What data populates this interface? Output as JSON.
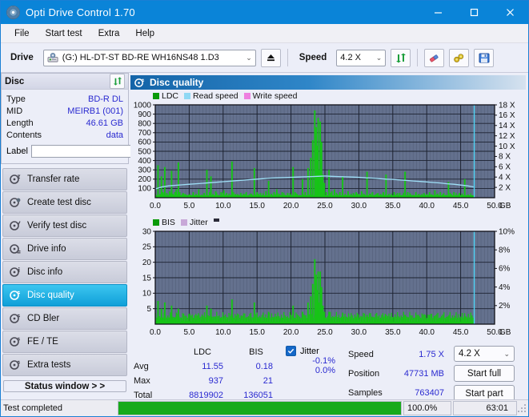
{
  "window": {
    "title": "Opti Drive Control 1.70",
    "icon": "disc-icon",
    "minimize": "—",
    "maximize": "❑",
    "close": "✕"
  },
  "menu": {
    "items": [
      "File",
      "Start test",
      "Extra",
      "Help"
    ]
  },
  "toolbar": {
    "drive_label": "Drive",
    "drive_value": "(G:)  HL-DT-ST BD-RE  WH16NS48 1.D3",
    "eject_icon": "eject-icon",
    "speed_label": "Speed",
    "speed_value": "4.2 X",
    "refresh_icon": "refresh-icon",
    "erase_icon": "erase-icon",
    "settings_icon": "tools-icon",
    "save_icon": "save-icon"
  },
  "disc": {
    "header": "Disc",
    "refresh_icon": "refresh-icon",
    "fields": [
      {
        "key": "Type",
        "value": "BD-R DL"
      },
      {
        "key": "MID",
        "value": "MEIRB1 (001)"
      },
      {
        "key": "Length",
        "value": "46.61 GB"
      },
      {
        "key": "Contents",
        "value": "data"
      }
    ],
    "label_key": "Label",
    "label_value": "",
    "label_placeholder": "",
    "disc_icon": "cd-icon"
  },
  "nav": {
    "items": [
      {
        "label": "Transfer rate",
        "icon": "disc-speed-icon",
        "selected": false
      },
      {
        "label": "Create test disc",
        "icon": "disc-write-icon",
        "selected": false
      },
      {
        "label": "Verify test disc",
        "icon": "disc-check-icon",
        "selected": false
      },
      {
        "label": "Drive info",
        "icon": "drive-info-icon",
        "selected": false
      },
      {
        "label": "Disc info",
        "icon": "disc-info-icon",
        "selected": false
      },
      {
        "label": "Disc quality",
        "icon": "disc-quality-icon",
        "selected": true
      },
      {
        "label": "CD Bler",
        "icon": "disc-bler-icon",
        "selected": false
      },
      {
        "label": "FE / TE",
        "icon": "disc-fete-icon",
        "selected": false
      },
      {
        "label": "Extra tests",
        "icon": "disc-extra-icon",
        "selected": false
      }
    ],
    "status_window": "Status window > >"
  },
  "panel": {
    "title": "Disc quality",
    "icon": "disc-quality-icon"
  },
  "stats": {
    "col_headers": [
      "LDC",
      "BIS"
    ],
    "rows": [
      {
        "key": "Avg",
        "ldc": "11.55",
        "bis": "0.18"
      },
      {
        "key": "Max",
        "ldc": "937",
        "bis": "21"
      },
      {
        "key": "Total",
        "ldc": "8819902",
        "bis": "136051"
      }
    ],
    "jitter_label": "Jitter",
    "jitter_checked": true,
    "jitter_values": [
      "-0.1%",
      "0.0%"
    ],
    "speed_key": "Speed",
    "speed_value": "1.75 X",
    "position_key": "Position",
    "position_value": "47731 MB",
    "samples_key": "Samples",
    "samples_value": "763407",
    "speed_select": "4.2 X",
    "start_full": "Start full",
    "start_part": "Start part"
  },
  "statusbar": {
    "message": "Test completed",
    "progress_percent": 100.0,
    "progress_text": "100.0%",
    "elapsed": "63:01"
  },
  "colors": {
    "accent": "#0a84d8",
    "ldc_green": "#17c417",
    "read_speed": "#8fd8f4",
    "write_speed": "#ee7fe0",
    "jitter": "#c8a8d8",
    "plot_bg": "#64718e",
    "selected_nav": "#0f9fd8",
    "progress_green": "#18aa1b",
    "value_blue": "#2a2ad0"
  },
  "chart_data": [
    {
      "type": "line",
      "id": "ldc-chart",
      "title": "",
      "xlabel": "GB",
      "ylabel": "",
      "xlim": [
        0,
        50
      ],
      "xticks": [
        0.0,
        5.0,
        10.0,
        15.0,
        20.0,
        25.0,
        30.0,
        35.0,
        40.0,
        45.0,
        50.0
      ],
      "xticklabels": [
        "0.0",
        "5.0",
        "10.0",
        "15.0",
        "20.0",
        "25.0",
        "30.0",
        "35.0",
        "40.0",
        "45.0",
        "50.0"
      ],
      "xunit": "GB",
      "ylim": [
        0,
        1000
      ],
      "yticks": [
        100,
        200,
        300,
        400,
        500,
        600,
        700,
        800,
        900,
        1000
      ],
      "yticklabels": [
        "100",
        "200",
        "300",
        "400",
        "500",
        "600",
        "700",
        "800",
        "900",
        "1000"
      ],
      "y2lim": [
        0,
        18
      ],
      "y2ticks": [
        2,
        4,
        6,
        8,
        10,
        12,
        14,
        16,
        18
      ],
      "y2ticklabels": [
        "2 X",
        "4 X",
        "6 X",
        "8 X",
        "10 X",
        "12 X",
        "14 X",
        "16 X",
        "18 X"
      ],
      "grid": true,
      "legend": [
        {
          "label": "LDC",
          "color": "#0a9a0a"
        },
        {
          "label": "Read speed",
          "color": "#8fd8f4"
        },
        {
          "label": "Write speed",
          "color": "#ee7fe0"
        }
      ],
      "series": [
        {
          "name": "LDC",
          "kind": "bars",
          "color": "#17c417",
          "x": [
            0.1,
            0.4,
            0.7,
            0.9,
            1.1,
            1.4,
            1.7,
            1.9,
            2.1,
            2.4,
            2.6,
            2.9,
            3.1,
            3.4,
            3.6,
            3.9,
            4.1,
            4.4,
            4.6,
            4.9,
            5.2,
            5.6,
            6.0,
            6.4,
            6.8,
            7.2,
            7.6,
            8.0,
            8.2,
            8.5,
            8.9,
            9.3,
            9.7,
            10.1,
            10.5,
            10.9,
            11.3,
            11.5,
            11.8,
            12.2,
            12.6,
            13.0,
            13.4,
            13.8,
            14.2,
            14.6,
            15.0,
            15.2,
            15.5,
            15.9,
            16.3,
            16.7,
            17.1,
            17.5,
            17.9,
            18.3,
            18.7,
            19.1,
            19.5,
            19.9,
            20.3,
            20.6,
            20.9,
            21.3,
            21.7,
            22.1,
            22.5,
            22.9,
            23.2,
            23.5,
            23.7,
            23.9,
            24.0,
            24.1,
            24.3,
            24.5,
            24.7,
            24.9,
            25.2,
            25.6,
            26.0,
            26.4,
            26.8,
            27.2,
            27.6,
            28.0,
            28.4,
            28.8,
            29.2,
            29.6,
            30.0,
            30.4,
            30.8,
            31.2,
            31.6,
            32.0,
            32.4,
            32.8,
            33.2,
            33.6,
            34.0,
            34.4,
            34.8,
            35.2,
            35.6,
            36.0,
            36.4,
            36.8,
            37.2,
            37.6,
            38.0,
            38.4,
            38.8,
            39.2,
            39.6,
            40.0,
            40.4,
            40.8,
            41.2,
            41.6,
            42.0,
            42.4,
            42.8,
            43.2,
            43.6,
            44.0,
            44.4,
            44.8,
            45.2,
            45.6,
            46.0,
            46.4,
            46.8
          ],
          "y": [
            20,
            350,
            40,
            230,
            60,
            330,
            50,
            30,
            70,
            290,
            40,
            60,
            90,
            380,
            60,
            30,
            50,
            40,
            30,
            25,
            20,
            60,
            40,
            90,
            30,
            50,
            300,
            60,
            230,
            40,
            70,
            30,
            60,
            80,
            50,
            30,
            390,
            60,
            40,
            30,
            50,
            40,
            60,
            30,
            40,
            320,
            60,
            40,
            50,
            30,
            70,
            180,
            40,
            60,
            90,
            40,
            60,
            30,
            50,
            40,
            330,
            60,
            40,
            30,
            200,
            60,
            320,
            430,
            620,
            940,
            760,
            560,
            860,
            300,
            820,
            600,
            250,
            160,
            60,
            300,
            70,
            90,
            40,
            60,
            230,
            40,
            70,
            30,
            50,
            60,
            40,
            70,
            30,
            280,
            40,
            60,
            30,
            50,
            40,
            60,
            250,
            40,
            30,
            60,
            40,
            50,
            30,
            280,
            60,
            40,
            30,
            60,
            40,
            30,
            50,
            40,
            60,
            30,
            80,
            40,
            60,
            40,
            30,
            170,
            40,
            60,
            30,
            50,
            40,
            200,
            30
          ]
        },
        {
          "name": "Read speed",
          "kind": "line",
          "color": "#9fe0f8",
          "axis": "y2",
          "x": [
            0.0,
            1.0,
            2.0,
            3.0,
            4.0,
            5.0,
            6.0,
            7.0,
            8.0,
            9.0,
            10.0,
            11.0,
            12.0,
            13.0,
            14.0,
            15.0,
            16.0,
            17.0,
            18.0,
            19.0,
            20.0,
            21.0,
            22.0,
            23.0,
            24.0,
            25.0,
            26.0,
            27.0,
            28.0,
            29.0,
            30.0,
            31.0,
            32.0,
            33.0,
            34.0,
            35.0,
            36.0,
            37.0,
            38.0,
            39.0,
            40.0,
            41.0,
            42.0,
            43.0,
            44.0,
            45.0,
            46.0,
            46.9
          ],
          "y": [
            1.7,
            2.1,
            2.3,
            2.4,
            2.5,
            2.6,
            2.7,
            2.8,
            2.9,
            3.0,
            3.1,
            3.2,
            3.3,
            3.4,
            3.5,
            3.6,
            3.7,
            3.8,
            3.85,
            3.9,
            3.95,
            4.0,
            4.05,
            4.1,
            4.15,
            4.2,
            4.15,
            4.1,
            4.05,
            4.0,
            3.95,
            3.85,
            3.8,
            3.7,
            3.6,
            3.55,
            3.45,
            3.35,
            3.25,
            3.15,
            3.05,
            2.95,
            2.85,
            2.7,
            2.6,
            2.45,
            2.3,
            2.1
          ]
        },
        {
          "name": "Write speed",
          "kind": "line",
          "color": "#ee7fe0",
          "axis": "y2",
          "x": [],
          "y": []
        }
      ],
      "markers": [
        {
          "type": "vline",
          "x": 47.0,
          "color": "#4fd4f4"
        }
      ]
    },
    {
      "type": "line",
      "id": "bis-chart",
      "title": "",
      "xlabel": "GB",
      "xlim": [
        0,
        50
      ],
      "xticks": [
        0.0,
        5.0,
        10.0,
        15.0,
        20.0,
        25.0,
        30.0,
        35.0,
        40.0,
        45.0,
        50.0
      ],
      "xticklabels": [
        "0.0",
        "5.0",
        "10.0",
        "15.0",
        "20.0",
        "25.0",
        "30.0",
        "35.0",
        "40.0",
        "45.0",
        "50.0"
      ],
      "xunit": "GB",
      "ylim": [
        0,
        30
      ],
      "yticks": [
        5,
        10,
        15,
        20,
        25,
        30
      ],
      "yticklabels": [
        "5",
        "10",
        "15",
        "20",
        "25",
        "30"
      ],
      "y2lim": [
        0,
        10
      ],
      "y2ticks": [
        2,
        4,
        6,
        8,
        10
      ],
      "y2ticklabels": [
        "2%",
        "4%",
        "6%",
        "8%",
        "10%"
      ],
      "grid": true,
      "legend": [
        {
          "label": "BIS",
          "color": "#0a9a0a"
        },
        {
          "label": "Jitter",
          "color": "#c8a8d8"
        }
      ],
      "series": [
        {
          "name": "BIS",
          "kind": "bars",
          "color": "#17c417",
          "x": [
            0.1,
            0.4,
            0.7,
            0.9,
            1.1,
            1.4,
            1.7,
            1.9,
            2.1,
            2.4,
            2.6,
            2.9,
            3.1,
            3.4,
            3.6,
            3.9,
            4.1,
            4.4,
            4.6,
            4.9,
            5.2,
            5.6,
            6.0,
            6.4,
            6.8,
            7.2,
            7.6,
            8.0,
            8.2,
            8.5,
            8.9,
            9.3,
            9.7,
            10.1,
            10.5,
            10.9,
            11.3,
            11.5,
            11.8,
            12.2,
            12.6,
            13.0,
            13.4,
            13.8,
            14.2,
            14.6,
            15.0,
            15.2,
            15.5,
            15.9,
            16.3,
            16.7,
            17.1,
            17.5,
            17.9,
            18.3,
            18.7,
            19.1,
            19.5,
            19.9,
            20.3,
            20.6,
            20.9,
            21.3,
            21.7,
            22.1,
            22.5,
            22.9,
            23.2,
            23.5,
            23.7,
            23.9,
            24.0,
            24.1,
            24.3,
            24.5,
            24.7,
            24.9,
            25.2,
            25.6,
            26.0,
            26.4,
            26.8,
            27.2,
            27.6,
            28.0,
            28.4,
            28.8,
            29.2,
            29.6,
            30.0,
            30.4,
            30.8,
            31.2,
            31.6,
            32.0,
            32.4,
            32.8,
            33.2,
            33.6,
            34.0,
            34.4,
            34.8,
            35.2,
            35.6,
            36.0,
            36.4,
            36.8,
            37.2,
            37.6,
            38.0,
            38.4,
            38.8,
            39.2,
            39.6,
            40.0,
            40.4,
            40.8,
            41.2,
            41.6,
            42.0,
            42.4,
            42.8,
            43.2,
            43.6,
            44.0,
            44.4,
            44.8,
            45.2,
            45.6,
            46.0,
            46.4,
            46.8
          ],
          "y": [
            1,
            7.5,
            1.5,
            5,
            1.5,
            7,
            1.5,
            1,
            2,
            6,
            1.5,
            2,
            2.5,
            5,
            1.5,
            1,
            1.5,
            1,
            1,
            1,
            1,
            2,
            1.5,
            3,
            1.5,
            2,
            6,
            2,
            5,
            1.5,
            2,
            1.5,
            2,
            2,
            1.5,
            1,
            8,
            2,
            1.5,
            1,
            1.5,
            1.5,
            2,
            1.5,
            1.5,
            7,
            2,
            1.5,
            1.5,
            1,
            2,
            4,
            1.5,
            2,
            2.5,
            1.5,
            2,
            1.5,
            1.5,
            1.5,
            6,
            2,
            1.5,
            1.5,
            4,
            2,
            7,
            9,
            13,
            21,
            16,
            11,
            17,
            7,
            17,
            12,
            6,
            4,
            1.5,
            4,
            1.5,
            2,
            1.5,
            2,
            3.5,
            1.5,
            2,
            1.5,
            1.5,
            2,
            1.5,
            2,
            1.5,
            3,
            1.5,
            2,
            1.5,
            1.5,
            1.5,
            2,
            3,
            1.5,
            1.5,
            2,
            1.5,
            1.5,
            1.5,
            3,
            2,
            1.5,
            1.5,
            2,
            1.5,
            1.5,
            1.5,
            1.5,
            2,
            1.5,
            2.5,
            1.5,
            2,
            1.5,
            1.5,
            2.5,
            1.5,
            2,
            1.5,
            1.5,
            1.5,
            2.5,
            1.5
          ]
        },
        {
          "name": "Jitter",
          "kind": "line",
          "color": "#c8a8d8",
          "axis": "y2",
          "x": [],
          "y": []
        }
      ],
      "markers": [
        {
          "type": "vline",
          "x": 47.0,
          "color": "#4fd4f4"
        }
      ]
    }
  ]
}
